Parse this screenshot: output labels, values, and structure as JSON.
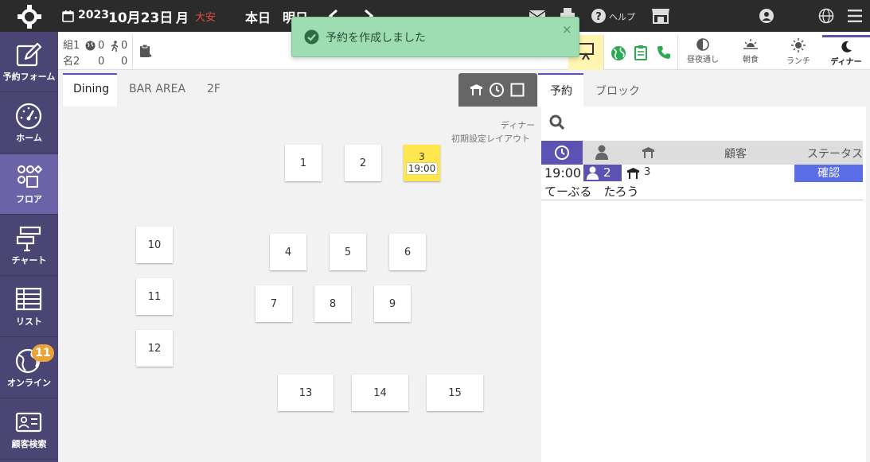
{
  "topbar": {
    "year": "2023",
    "date": "10月23日",
    "weekday": "月",
    "rokuyo": "大安",
    "today": "本日",
    "tomorrow": "明日",
    "help": "ヘルプ"
  },
  "sidebar": {
    "items": [
      {
        "label": "予約フォーム",
        "icon": "edit-icon"
      },
      {
        "label": "ホーム",
        "icon": "dashboard-icon"
      },
      {
        "label": "フロア",
        "icon": "floor-icon"
      },
      {
        "label": "チャート",
        "icon": "chart-icon"
      },
      {
        "label": "リスト",
        "icon": "list-icon"
      },
      {
        "label": "オンライン",
        "icon": "globe-icon",
        "badge": "11"
      },
      {
        "label": "顧客検索",
        "icon": "customer-card-icon"
      }
    ]
  },
  "info": {
    "groups_label": "組",
    "groups": "1",
    "people_label": "名",
    "people": "2",
    "online_groups": "0",
    "online_people": "0",
    "walkin_groups": "0",
    "walkin_people": "0"
  },
  "modes": [
    {
      "label": "昼夜通し",
      "icon": "half-moon-icon"
    },
    {
      "label": "朝食",
      "icon": "sunrise-icon"
    },
    {
      "label": "ランチ",
      "icon": "sun-icon"
    },
    {
      "label": "ディナー",
      "icon": "moon-icon"
    }
  ],
  "toast": {
    "message": "予約を作成しました",
    "close": "×"
  },
  "floor": {
    "tabs": [
      "Dining",
      "BAR AREA",
      "2F"
    ],
    "service": "ディナー",
    "layout": "初期設定レイアウト",
    "tables": [
      "1",
      "2",
      "3",
      "4",
      "5",
      "6",
      "7",
      "8",
      "9",
      "10",
      "11",
      "12",
      "13",
      "14",
      "15"
    ],
    "reserved_time": "19:00"
  },
  "right": {
    "tabs": [
      "予約",
      "ブロック"
    ],
    "columns": {
      "customer": "顧客",
      "status": "ステータス"
    },
    "reservation": {
      "time": "19:00",
      "party": "2",
      "table": "3",
      "status": "確認",
      "name": "てーぶる　たろう"
    }
  },
  "colors": {
    "accent": "#5b52b3",
    "reserved": "#ffe74d",
    "toast": "#9edcb1",
    "sidebar": "#4a4572"
  }
}
